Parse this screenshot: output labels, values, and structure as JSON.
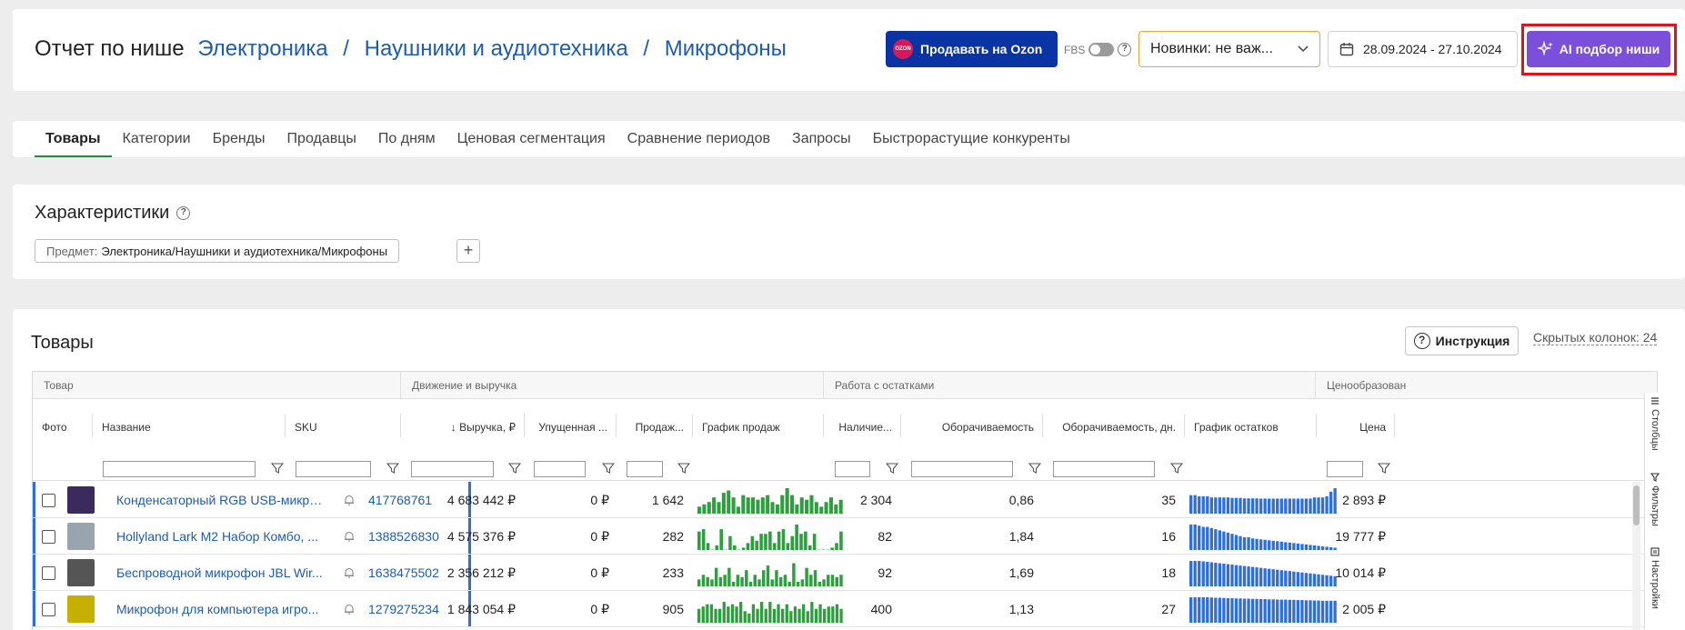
{
  "header": {
    "title_prefix": "Отчет по нише",
    "breadcrumbs": [
      "Электроника",
      "Наушники и аудиотехника",
      "Микрофоны"
    ],
    "breadcrumb_separator": "/",
    "ozon_button": "Продавать на Ozon",
    "ozon_logo_text": "OZON",
    "fbs_label": "FBS",
    "fbs_enabled": false,
    "novelty_select": "Новинки: не важ...",
    "date_range": "28.09.2024 - 27.10.2024",
    "ai_button": "AI подбор ниши"
  },
  "tabs": [
    "Товары",
    "Категории",
    "Бренды",
    "Продавцы",
    "По дням",
    "Ценовая сегментация",
    "Сравнение периодов",
    "Запросы",
    "Быстрорастущие конкуренты"
  ],
  "active_tab": "Товары",
  "characteristics": {
    "title": "Характеристики",
    "chip_key": "Предмет:",
    "chip_value": "Электроника/Наушники и аудиотехника/Микрофоны",
    "add_label": "+"
  },
  "products": {
    "title": "Товары",
    "instruction_button": "Инструкция",
    "hidden_columns": "Скрытых колонок: 24",
    "groups": [
      "Товар",
      "Движение и выручка",
      "Работа с остатками",
      "Ценообразован"
    ],
    "columns": [
      "Фото",
      "Название",
      "SKU",
      "↓ Выручка, ₽",
      "Упущенная ...",
      "Продаж...",
      "График продаж",
      "Наличие...",
      "Оборачиваемость",
      "Оборачиваемость, дн.",
      "График остатков",
      "Цена"
    ],
    "rows": [
      {
        "name": "Конденсаторный RGB USB-микро...",
        "sku": "417768761",
        "revenue": "4 683 442 ₽",
        "lost": "0 ₽",
        "sales": "1 642",
        "stock": "2 304",
        "turnover": "0,86",
        "turnover_days": "35",
        "price": "2 893 ₽",
        "thumb_color": "#3a2a5e",
        "sales_chart": [
          3,
          4,
          5,
          7,
          5,
          9,
          10,
          7,
          3,
          8,
          7,
          7,
          6,
          7,
          8,
          5,
          4,
          8,
          11,
          8,
          4,
          7,
          6,
          8,
          5,
          3,
          5,
          7,
          4,
          6
        ],
        "stock_chart": [
          8,
          8,
          7.5,
          7.5,
          7.5,
          7,
          7,
          7,
          7,
          7,
          6.8,
          6.8,
          6.8,
          6.6,
          6.6,
          6.6,
          6.6,
          6.5,
          6.5,
          6.5,
          6.5,
          6.5,
          6.5,
          6.5,
          6.5,
          6.5,
          6.5,
          6.5,
          6.5,
          6.5,
          7,
          7,
          7,
          7.5,
          9.5,
          11
        ]
      },
      {
        "name": "Hollyland Lark M2 Набор Комбо, ...",
        "sku": "1388526830",
        "revenue": "4 575 376 ₽",
        "lost": "0 ₽",
        "sales": "282",
        "stock": "82",
        "turnover": "1,84",
        "turnover_days": "16",
        "price": "19 777 ₽",
        "thumb_color": "#9aa3b0",
        "sales_chart": [
          8,
          9,
          3,
          0,
          2,
          9,
          0,
          6,
          2,
          0,
          1,
          3,
          6,
          4,
          7,
          7,
          8,
          3,
          8,
          9,
          3,
          6,
          11,
          7,
          8,
          2,
          7,
          0,
          0,
          0,
          1,
          3,
          8
        ],
        "stock_chart": [
          11,
          11,
          10.5,
          10,
          10,
          9.5,
          9,
          8.5,
          8,
          7.5,
          7,
          6.5,
          6,
          5.5,
          5.5,
          5,
          4.8,
          4.6,
          4.4,
          4.2,
          4,
          3.8,
          3.6,
          3.4,
          3.2,
          3,
          2.8,
          2.6,
          2.4,
          2.2,
          2,
          1.8,
          1.6,
          1.4,
          1.2,
          1
        ]
      },
      {
        "name": "Беспроводной микрофон JBL Wir...",
        "sku": "1638475502",
        "revenue": "2 356 212 ₽",
        "lost": "0 ₽",
        "sales": "233",
        "stock": "92",
        "turnover": "1,69",
        "turnover_days": "18",
        "price": "10 014 ₽",
        "thumb_color": "#555555",
        "sales_chart": [
          3,
          5,
          4,
          3,
          8,
          4,
          5,
          8,
          2,
          5,
          4,
          7,
          2,
          5,
          3,
          7,
          9,
          3,
          7,
          4,
          5,
          2,
          10,
          2,
          3,
          8,
          5,
          7,
          2,
          3,
          5,
          5,
          4,
          5
        ],
        "stock_chart": [
          11,
          11,
          11,
          10.8,
          10.6,
          10.4,
          10.2,
          10,
          9.8,
          9.6,
          9.4,
          9.2,
          9,
          8.8,
          8.6,
          8.4,
          8.2,
          8,
          7.8,
          7.6,
          7.4,
          7.2,
          7,
          6.8,
          6.6,
          6.4,
          6.2,
          6,
          5.8,
          5.6,
          5.4,
          5.2,
          5,
          4.8,
          4.6,
          4.4
        ]
      },
      {
        "name": "Микрофон для компьютера игро...",
        "sku": "1279275234",
        "revenue": "1 843 054 ₽",
        "lost": "0 ₽",
        "sales": "905",
        "stock": "400",
        "turnover": "1,13",
        "turnover_days": "27",
        "price": "2 005 ₽",
        "thumb_color": "#c5b000",
        "sales_chart": [
          6,
          7,
          8,
          8,
          6,
          6,
          9,
          7,
          8,
          7,
          9,
          5,
          4,
          8,
          6,
          9,
          6,
          9,
          6,
          8,
          6,
          8,
          5,
          7,
          6,
          8,
          5,
          9,
          6,
          8,
          6,
          7,
          7,
          8,
          6
        ],
        "stock_chart": [
          11,
          11,
          11,
          11,
          11,
          10.9,
          10.8,
          10.8,
          10.7,
          10.6,
          10.6,
          10.5,
          10.5,
          10.4,
          10.4,
          10.3,
          10.3,
          10.2,
          10.2,
          10.1,
          10.1,
          10,
          10,
          10,
          9.9,
          9.9,
          9.8,
          9.8,
          9.7,
          9.7,
          9.6,
          9.6,
          9.5,
          9.5,
          9.5,
          9.5
        ]
      }
    ]
  },
  "side_rail": [
    "Столбцы",
    "Фильтры",
    "Настройки"
  ],
  "colors": {
    "brand_link": "#1f5da8",
    "ozon_blue": "#0a34a3",
    "ai_purple": "#7c4fdb",
    "highlight_red": "#e0151b",
    "spark_green": "#2e9e3e",
    "spark_blue": "#2f6fd6",
    "tab_green": "#1e8c3a",
    "select_border": "#f0a43a"
  }
}
